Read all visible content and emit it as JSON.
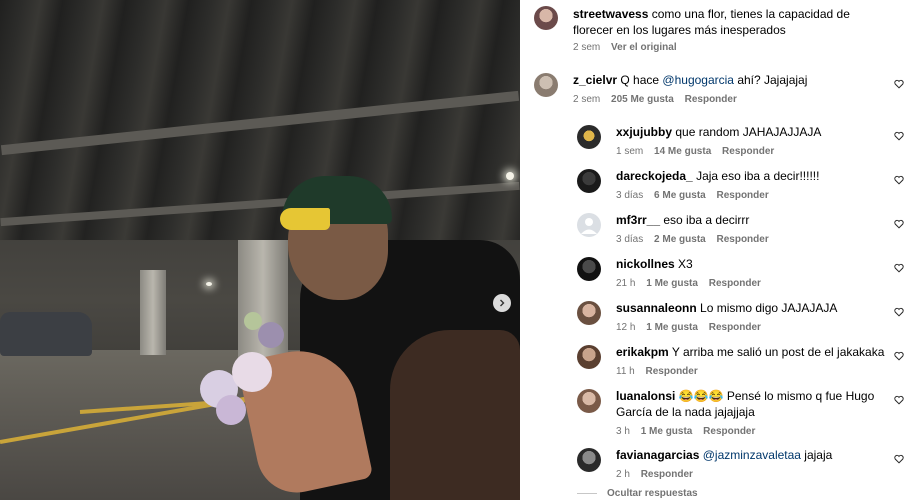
{
  "photo": {
    "next_icon": "chevron-right-icon"
  },
  "caption": {
    "username": "streetwavess",
    "text": "como una flor, tienes la capacidad de florecer en los lugares más inesperados",
    "time": "2 sem",
    "translate": "Ver el original"
  },
  "comments": [
    {
      "username": "z_cielvr",
      "pre": "Q hace ",
      "mention": "@hugogarcia",
      "post": " ahí? Jajajajaj",
      "time": "2 sem",
      "likes": "205 Me gusta",
      "reply": "Responder"
    },
    {
      "username": "xxjujubby",
      "pre": "que random JAHAJAJJAJA",
      "time": "1 sem",
      "likes": "14 Me gusta",
      "reply": "Responder"
    },
    {
      "username": "dareckojeda_",
      "pre": "Jaja eso iba a decir!!!!!!",
      "time": "3 días",
      "likes": "6 Me gusta",
      "reply": "Responder"
    },
    {
      "username": "mf3rr__",
      "pre": "eso iba a decirrr",
      "time": "3 días",
      "likes": "2 Me gusta",
      "reply": "Responder"
    },
    {
      "username": "nickollnes",
      "pre": "X3",
      "time": "21 h",
      "likes": "1 Me gusta",
      "reply": "Responder"
    },
    {
      "username": "susannaleonn",
      "pre": "Lo mismo digo JAJAJAJA",
      "time": "12 h",
      "likes": "1 Me gusta",
      "reply": "Responder"
    },
    {
      "username": "erikakpm",
      "pre": "Y arriba me salió un post de el jakakaka",
      "time": "11 h",
      "reply": "Responder"
    },
    {
      "username": "luanalonsi",
      "pre": "😂😂😂 Pensé lo mismo q fue Hugo García de la nada jajajjaja",
      "time": "3 h",
      "likes": "1 Me gusta",
      "reply": "Responder"
    },
    {
      "username": "favianagarcias",
      "mention": "@jazminzavaletaa",
      "post": " jajaja",
      "time": "2 h",
      "reply": "Responder"
    }
  ],
  "hide_replies": "Ocultar respuestas",
  "colors": {
    "muted": "#737373",
    "mention": "#00376b"
  }
}
